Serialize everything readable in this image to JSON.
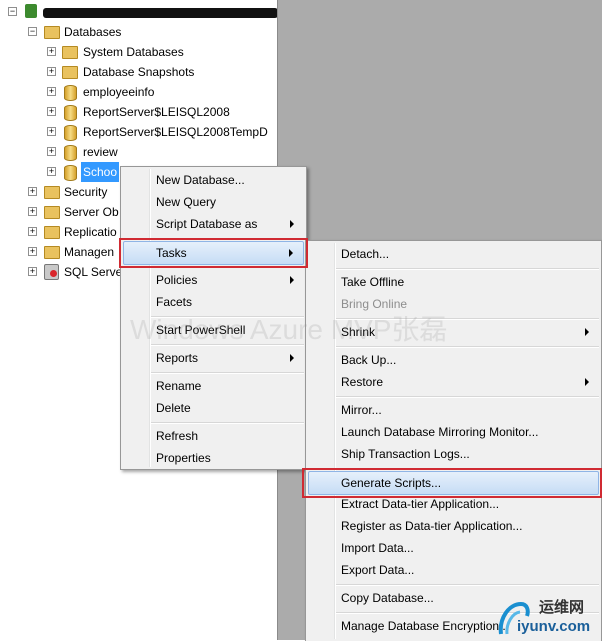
{
  "tree": {
    "server": "",
    "databases": "Databases",
    "system_databases": "System Databases",
    "database_snapshots": "Database Snapshots",
    "employeeinfo": "employeeinfo",
    "reportserver": "ReportServer$LEISQL2008",
    "reportserver_temp": "ReportServer$LEISQL2008TempD",
    "review": "review",
    "school": "Schoo",
    "security": "Security",
    "server_objects": "Server Ob",
    "replication": "Replicatio",
    "management": "Managen",
    "sql_server_agent": "SQL Serve"
  },
  "context_menu": {
    "new_database": "New Database...",
    "new_query": "New Query",
    "script_database_as": "Script Database as",
    "tasks": "Tasks",
    "policies": "Policies",
    "facets": "Facets",
    "start_powershell": "Start PowerShell",
    "reports": "Reports",
    "rename": "Rename",
    "delete": "Delete",
    "refresh": "Refresh",
    "properties": "Properties"
  },
  "tasks_menu": {
    "detach": "Detach...",
    "take_offline": "Take Offline",
    "bring_online": "Bring Online",
    "shrink": "Shrink",
    "back_up": "Back Up...",
    "restore": "Restore",
    "mirror": "Mirror...",
    "launch_mirroring_monitor": "Launch Database Mirroring Monitor...",
    "ship_transaction_logs": "Ship Transaction Logs...",
    "generate_scripts": "Generate Scripts...",
    "extract_data_tier": "Extract Data-tier Application...",
    "register_data_tier": "Register as Data-tier Application...",
    "import_data": "Import Data...",
    "export_data": "Export Data...",
    "copy_database": "Copy Database...",
    "manage_encryption": "Manage Database Encryption..."
  },
  "watermark": "Windows Azure MVP张磊",
  "logo": {
    "name": "运维网",
    "url": "iyunv.com"
  },
  "colors": {
    "highlight_border": "#d02a32",
    "selection": "#3399ff",
    "menu_bg": "#f0f0f0",
    "background_gray": "#ababab"
  }
}
